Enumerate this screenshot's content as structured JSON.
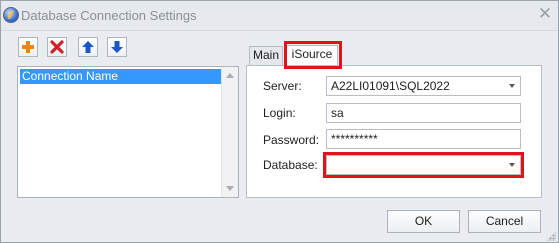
{
  "window": {
    "title": "Database Connection Settings",
    "close_glyph": "✕"
  },
  "toolbar": {
    "buttons": [
      {
        "icon": "add-icon",
        "color": "#e8861a"
      },
      {
        "icon": "delete-icon",
        "color": "#d0202a"
      },
      {
        "icon": "arrow-up-icon",
        "color": "#1a56c9"
      },
      {
        "icon": "arrow-down-icon",
        "color": "#1a56c9"
      }
    ]
  },
  "connections": {
    "items": [
      "Connection Name"
    ]
  },
  "tabs": {
    "main_label": "Main",
    "isource_label": "iSource"
  },
  "form": {
    "server_label": "Server:",
    "server_value": "A22LI01091\\SQL2022",
    "login_label": "Login:",
    "login_value": "sa",
    "password_label": "Password:",
    "password_value": "**********",
    "database_label": "Database:",
    "database_value": ""
  },
  "buttons": {
    "ok_label": "OK",
    "cancel_label": "Cancel"
  },
  "colors": {
    "highlight": "#e0131b",
    "selection": "#3399ff"
  }
}
